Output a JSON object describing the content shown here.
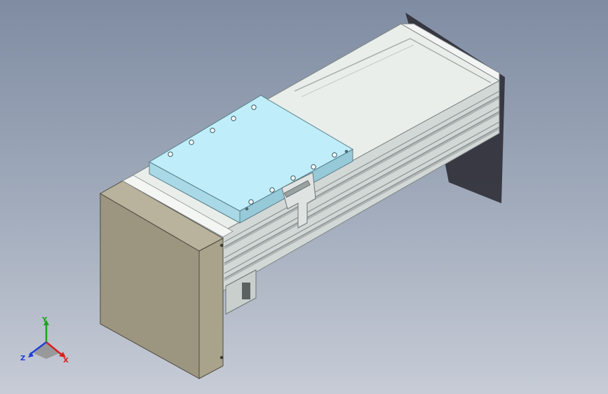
{
  "viewport": {
    "background_top": "#7f8ca2",
    "background_bottom": "#c7ccd6"
  },
  "model": {
    "name": "linear-actuator",
    "colors": {
      "rail_top": "#e9eeea",
      "rail_face": "#d2d8d6",
      "rail_shadow": "#b8bebf",
      "carriage_top": "#bfeefa",
      "carriage_side": "#97cad8",
      "end_plate": "#9c9580",
      "end_plate_edge": "#b9b29c",
      "shadow": "#2e2e36"
    }
  },
  "triad": {
    "x_label": "X",
    "y_label": "Y",
    "z_label": "Z",
    "x_color": "#d62020",
    "y_color": "#1aa51a",
    "z_color": "#1f3fd8"
  }
}
